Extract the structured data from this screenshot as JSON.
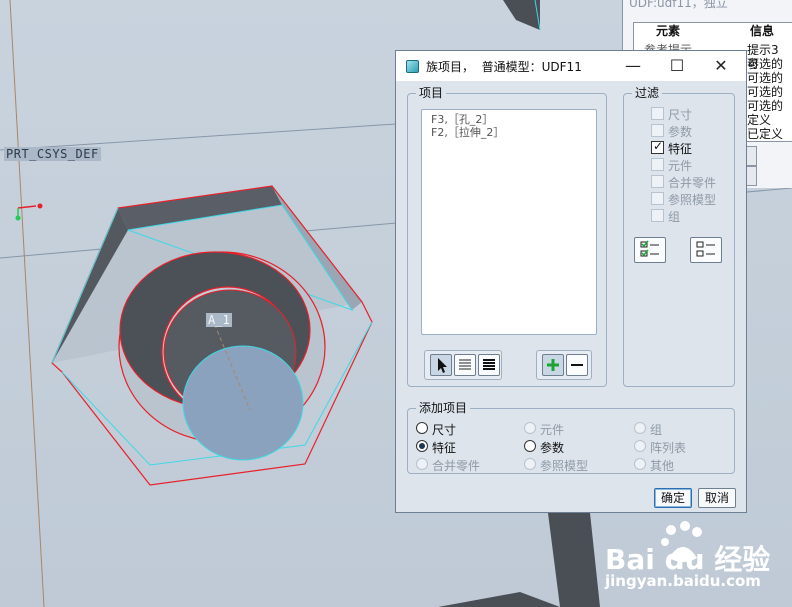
{
  "viewport": {
    "csys_label": "PRT_CSYS_DEF",
    "axis_label": "A_1"
  },
  "background_window": {
    "title": "UDF:udf11，独立",
    "columns": [
      "元素",
      "信息"
    ],
    "info_rows": [
      "提示3 参",
      "可选的",
      "可选的",
      "可选的",
      "可选的",
      "定义",
      "已定义"
    ],
    "left_row": "参考提示"
  },
  "dialog": {
    "title": "族项目，  普通模型：UDF11",
    "minimize_label": "—",
    "maximize_label": "☐",
    "close_label": "✕",
    "items_group": {
      "legend": "项目",
      "list": [
        "F3,［孔_2］",
        "F2,［拉伸_2］"
      ]
    },
    "filter_group": {
      "legend": "过滤",
      "checkboxes": [
        {
          "label": "尺寸",
          "checked": false,
          "enabled": false
        },
        {
          "label": "参数",
          "checked": false,
          "enabled": false
        },
        {
          "label": "特征",
          "checked": true,
          "enabled": true
        },
        {
          "label": "元件",
          "checked": false,
          "enabled": false
        },
        {
          "label": "合并零件",
          "checked": false,
          "enabled": false
        },
        {
          "label": "参照模型",
          "checked": false,
          "enabled": false
        },
        {
          "label": "组",
          "checked": false,
          "enabled": false
        }
      ]
    },
    "add_group": {
      "legend": "添加项目",
      "radios": [
        {
          "label": "尺寸",
          "checked": false,
          "enabled": true
        },
        {
          "label": "元件",
          "checked": false,
          "enabled": false
        },
        {
          "label": "组",
          "checked": false,
          "enabled": false
        },
        {
          "label": "特征",
          "checked": true,
          "enabled": true
        },
        {
          "label": "参数",
          "checked": false,
          "enabled": true
        },
        {
          "label": "阵列表",
          "checked": false,
          "enabled": false
        },
        {
          "label": "合并零件",
          "checked": false,
          "enabled": false
        },
        {
          "label": "参照模型",
          "checked": false,
          "enabled": false
        },
        {
          "label": "其他",
          "checked": false,
          "enabled": false
        }
      ]
    },
    "ok_label": "确定",
    "cancel_label": "取消"
  },
  "watermark": {
    "brand": "Bai du 经验",
    "url": "jingyan.baidu.com"
  },
  "colors": {
    "model_edge_red": "#e8202a",
    "model_edge_cyan": "#3fd8e6",
    "dialog_body": "#dde4ec",
    "add_icon_green": "#1aa532"
  }
}
